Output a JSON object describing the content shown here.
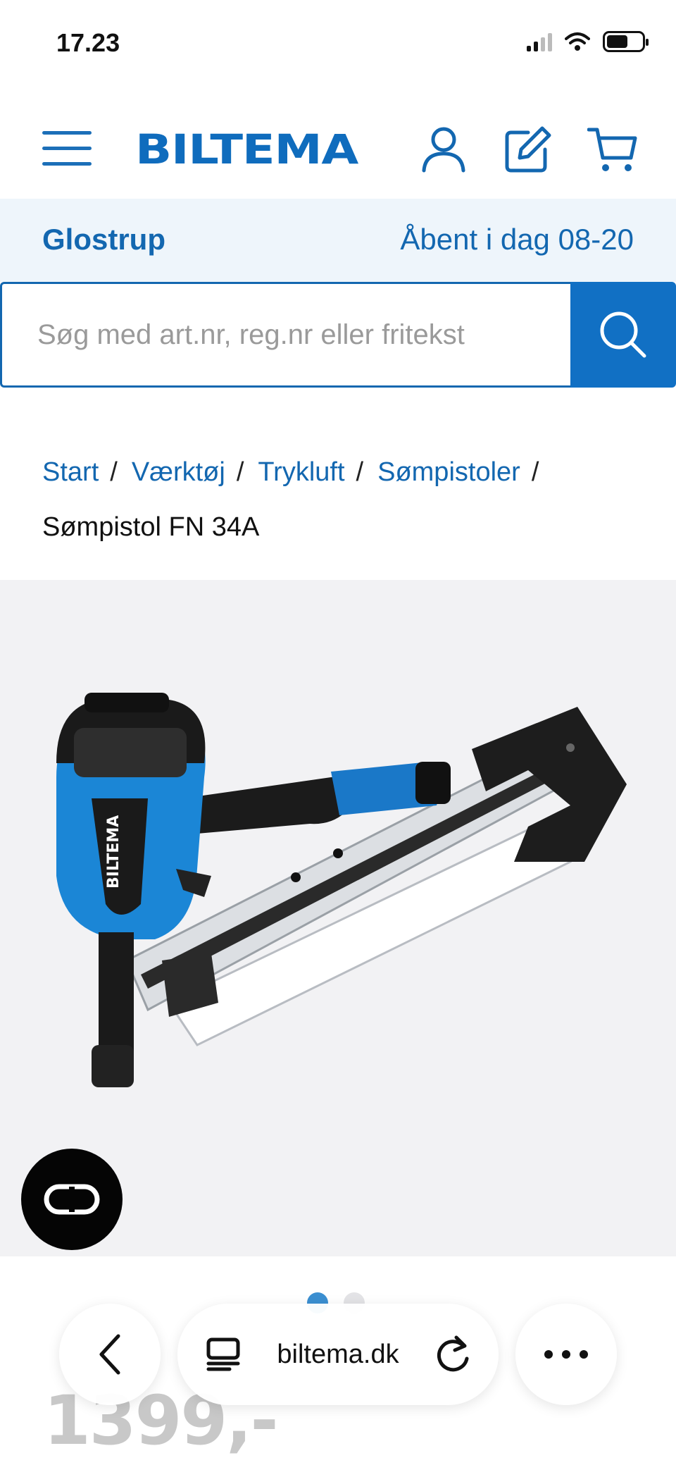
{
  "status_bar": {
    "time": "17.23"
  },
  "header": {
    "logo": "BILTEMA",
    "icons": [
      "menu-icon",
      "user-icon",
      "edit-icon",
      "cart-icon"
    ]
  },
  "store": {
    "name": "Glostrup",
    "hours": "Åbent i dag 08-20"
  },
  "search": {
    "placeholder": "Søg med art.nr, reg.nr eller fritekst"
  },
  "breadcrumb": {
    "items": [
      "Start",
      "Værktøj",
      "Trykluft",
      "Sømpistoler"
    ],
    "separator": "/",
    "current": "Sømpistol FN 34A"
  },
  "product": {
    "price": "1399,-",
    "image_brand_text": "BILTEMA",
    "carousel": {
      "count": 2,
      "active_index": 0
    }
  },
  "browser_toolbar": {
    "url": "biltema.dk"
  },
  "colors": {
    "brand_blue": "#1170c4",
    "link_blue": "#1367b0",
    "store_bar_bg": "#eef5fb",
    "product_bg": "#f2f2f4"
  }
}
